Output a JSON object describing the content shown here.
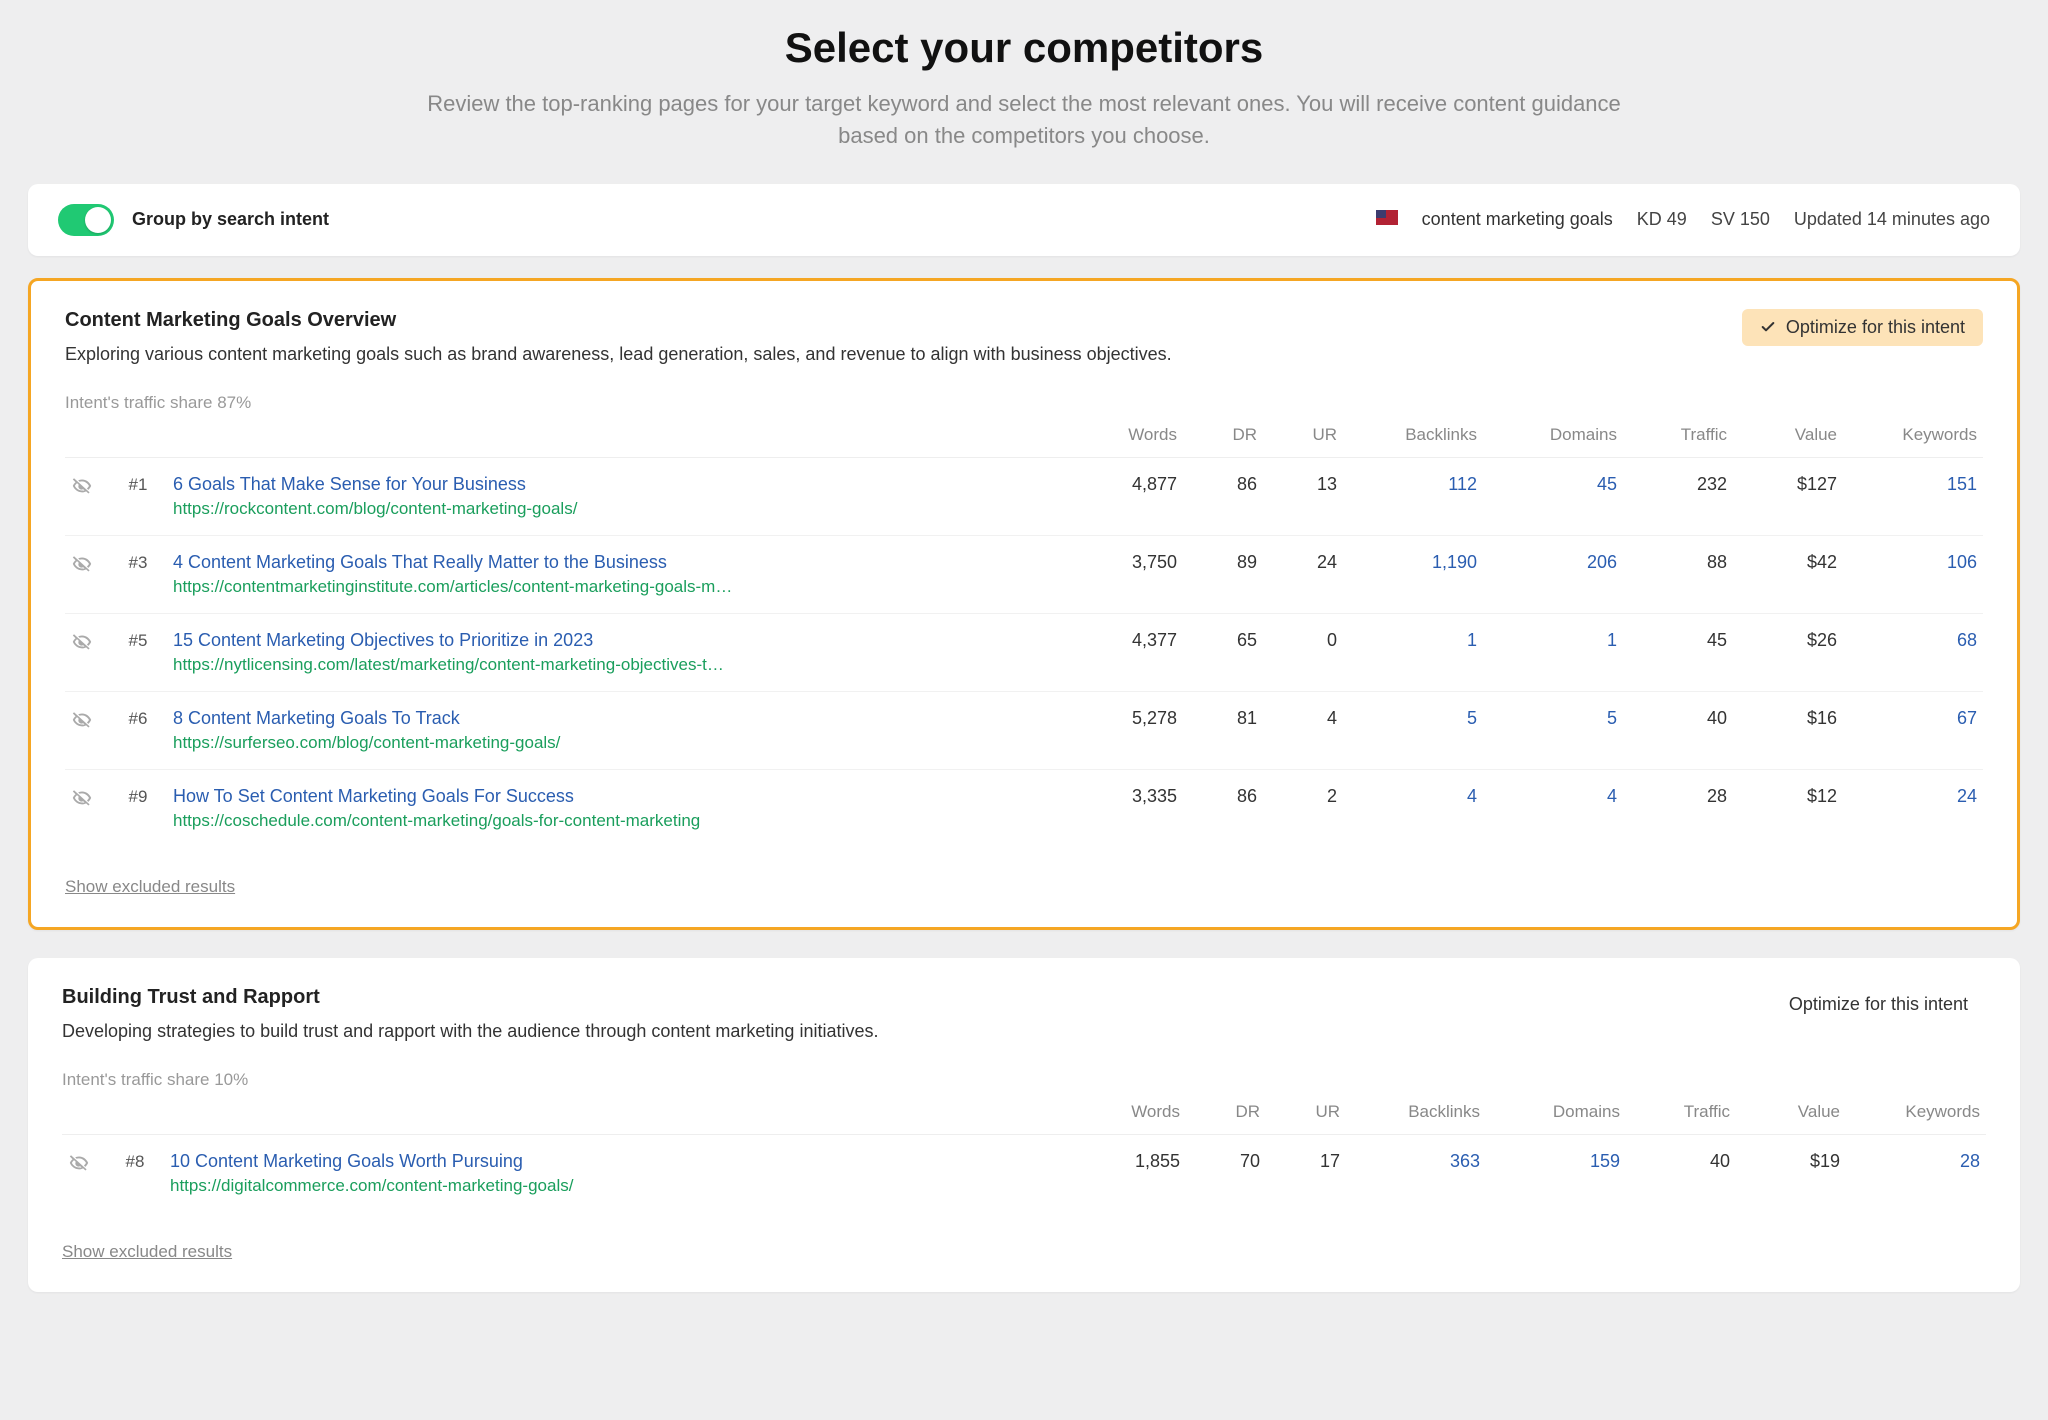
{
  "header": {
    "title": "Select your competitors",
    "subtitle": "Review the top-ranking pages for your target keyword and select the most relevant ones. You will receive content guidance based on the competitors you choose."
  },
  "toolbar": {
    "group_label": "Group by search intent",
    "keyword": "content marketing goals",
    "kd_label": "KD 49",
    "sv_label": "SV 150",
    "updated_label": "Updated 14 minutes ago"
  },
  "columns": {
    "words": "Words",
    "dr": "DR",
    "ur": "UR",
    "backlinks": "Backlinks",
    "domains": "Domains",
    "traffic": "Traffic",
    "value": "Value",
    "keywords": "Keywords"
  },
  "optimize_label": "Optimize for this intent",
  "show_excluded_label": "Show excluded results",
  "groups": [
    {
      "active": true,
      "title": "Content Marketing Goals Overview",
      "description": "Exploring various content marketing goals such as brand awareness, lead generation, sales, and revenue to align with business objectives.",
      "traffic_share": "Intent's traffic share 87%",
      "rows": [
        {
          "rank": "#1",
          "title": "6 Goals That Make Sense for Your Business",
          "url": "https://rockcontent.com/blog/content-marketing-goals/",
          "words": "4,877",
          "dr": "86",
          "ur": "13",
          "backlinks": "112",
          "domains": "45",
          "traffic": "232",
          "value": "$127",
          "keywords": "151"
        },
        {
          "rank": "#3",
          "title": "4 Content Marketing Goals That Really Matter to the Business",
          "url": "https://contentmarketinginstitute.com/articles/content-marketing-goals-m…",
          "words": "3,750",
          "dr": "89",
          "ur": "24",
          "backlinks": "1,190",
          "domains": "206",
          "traffic": "88",
          "value": "$42",
          "keywords": "106"
        },
        {
          "rank": "#5",
          "title": "15 Content Marketing Objectives to Prioritize in 2023",
          "url": "https://nytlicensing.com/latest/marketing/content-marketing-objectives-t…",
          "words": "4,377",
          "dr": "65",
          "ur": "0",
          "backlinks": "1",
          "domains": "1",
          "traffic": "45",
          "value": "$26",
          "keywords": "68"
        },
        {
          "rank": "#6",
          "title": "8 Content Marketing Goals To Track",
          "url": "https://surferseo.com/blog/content-marketing-goals/",
          "words": "5,278",
          "dr": "81",
          "ur": "4",
          "backlinks": "5",
          "domains": "5",
          "traffic": "40",
          "value": "$16",
          "keywords": "67"
        },
        {
          "rank": "#9",
          "title": "How To Set Content Marketing Goals For Success",
          "url": "https://coschedule.com/content-marketing/goals-for-content-marketing",
          "words": "3,335",
          "dr": "86",
          "ur": "2",
          "backlinks": "4",
          "domains": "4",
          "traffic": "28",
          "value": "$12",
          "keywords": "24"
        }
      ]
    },
    {
      "active": false,
      "title": "Building Trust and Rapport",
      "description": "Developing strategies to build trust and rapport with the audience through content marketing initiatives.",
      "traffic_share": "Intent's traffic share 10%",
      "rows": [
        {
          "rank": "#8",
          "title": "10 Content Marketing Goals Worth Pursuing",
          "url": "https://digitalcommerce.com/content-marketing-goals/",
          "words": "1,855",
          "dr": "70",
          "ur": "17",
          "backlinks": "363",
          "domains": "159",
          "traffic": "40",
          "value": "$19",
          "keywords": "28"
        }
      ]
    }
  ]
}
